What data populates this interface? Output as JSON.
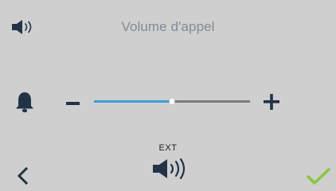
{
  "screen": {
    "title": "Volume d'appel",
    "background_color": "#cfcfcf"
  },
  "icons": {
    "header": "speaker-icon",
    "ringer": "bell-icon",
    "decrease": "minus-icon",
    "increase": "plus-icon",
    "output": "speaker-icon",
    "back": "chevron-left-icon",
    "confirm": "checkmark-icon"
  },
  "volume": {
    "level_fraction": 0.5,
    "fill_color": "#3aa0d6",
    "track_color": "#7c7c7c"
  },
  "output": {
    "label": "EXT"
  },
  "colors": {
    "title": "#7f8d96",
    "icons_dark": "#223348",
    "confirm": "#8cc63f"
  }
}
